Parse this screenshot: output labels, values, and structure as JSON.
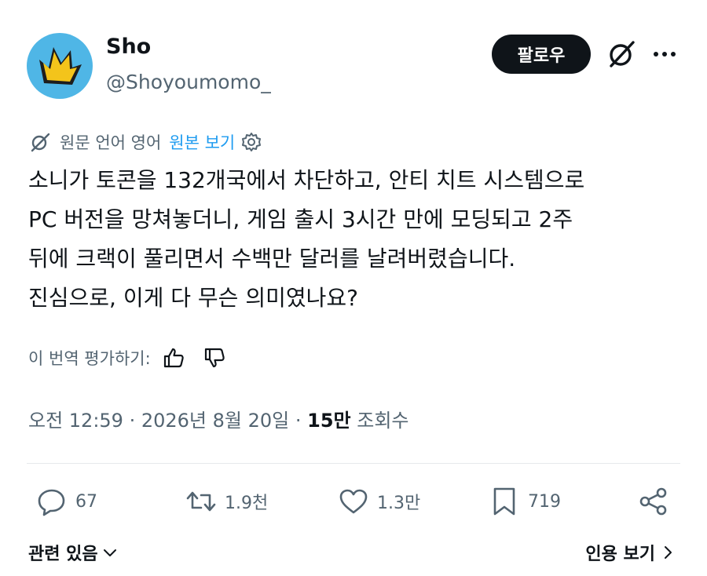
{
  "author": {
    "name": "Sho",
    "handle": "@Shoyoumomo_"
  },
  "header": {
    "follow_label": "팔로우"
  },
  "translation": {
    "note": "원문 언어 영어",
    "view_original": "원본 보기"
  },
  "post": {
    "lines": [
      "소니가 토콘을 132개국에서 차단하고, 안티 치트 시스템으로",
      "PC 버전을 망쳐놓더니, 게임 출시 3시간 만에 모딩되고 2주",
      "뒤에 크랙이 풀리면서 수백만 달러를 날려버렸습니다.",
      "진심으로, 이게 다 무슨 의미였나요?"
    ]
  },
  "rating": {
    "label": "이 번역 평가하기:"
  },
  "meta": {
    "time": "오전 12:59 · 2026년 8월 20일 ·",
    "views_count": "15만",
    "views_label": "조회수"
  },
  "actions": {
    "replies": "67",
    "reposts": "1.9천",
    "likes": "1.3만",
    "bookmarks": "719"
  },
  "footer": {
    "related_label": "관련 있음",
    "quotes_label": "인용 보기"
  },
  "colors": {
    "accent": "#1d9bf0",
    "text": "#0f1419",
    "muted": "#536471",
    "avatar_bg": "#4fb6e6",
    "avatar_mark": "#f3c41b"
  }
}
